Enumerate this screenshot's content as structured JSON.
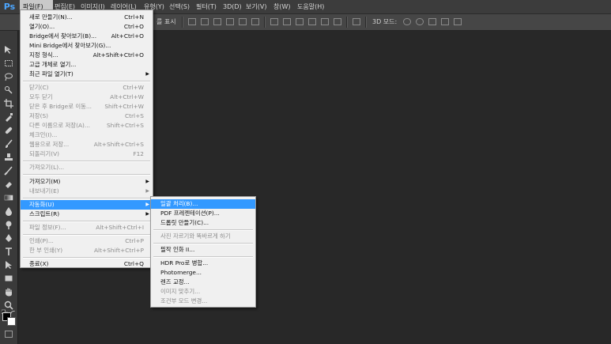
{
  "app": {
    "logo": "Ps"
  },
  "menubar": {
    "items": [
      {
        "label": "파일(F)"
      },
      {
        "label": "편집(E)"
      },
      {
        "label": "이미지(I)"
      },
      {
        "label": "레이어(L)"
      },
      {
        "label": "유형(Y)"
      },
      {
        "label": "선택(S)"
      },
      {
        "label": "필터(T)"
      },
      {
        "label": "3D(D)"
      },
      {
        "label": "보기(V)"
      },
      {
        "label": "창(W)"
      },
      {
        "label": "도움말(H)"
      }
    ]
  },
  "optionsbar": {
    "show_transform": "를 표시",
    "mode_3d": "3D 모드:"
  },
  "file_menu": {
    "items": [
      {
        "label": "새로 만들기(N)...",
        "shortcut": "Ctrl+N",
        "enabled": true
      },
      {
        "label": "열기(O)...",
        "shortcut": "Ctrl+O",
        "enabled": true
      },
      {
        "label": "Bridge에서 찾아보기(B)...",
        "shortcut": "Alt+Ctrl+O",
        "enabled": true
      },
      {
        "label": "Mini Bridge에서 찾아보기(G)...",
        "shortcut": "",
        "enabled": true
      },
      {
        "label": "지정 형식...",
        "shortcut": "Alt+Shift+Ctrl+O",
        "enabled": true
      },
      {
        "label": "고급 개체로 열기...",
        "shortcut": "",
        "enabled": true
      },
      {
        "label": "최근 파일 열기(T)",
        "shortcut": "",
        "enabled": true,
        "submenu": true
      },
      {
        "label": "닫기(C)",
        "shortcut": "Ctrl+W",
        "enabled": false
      },
      {
        "label": "모두 닫기",
        "shortcut": "Alt+Ctrl+W",
        "enabled": false
      },
      {
        "label": "닫은 후 Bridge로 이동...",
        "shortcut": "Shift+Ctrl+W",
        "enabled": false
      },
      {
        "label": "저장(S)",
        "shortcut": "Ctrl+S",
        "enabled": false
      },
      {
        "label": "다른 이름으로 저장(A)...",
        "shortcut": "Shift+Ctrl+S",
        "enabled": false
      },
      {
        "label": "체크인(I)...",
        "shortcut": "",
        "enabled": false
      },
      {
        "label": "웹용으로 저장...",
        "shortcut": "Alt+Shift+Ctrl+S",
        "enabled": false
      },
      {
        "label": "되돌리기(V)",
        "shortcut": "F12",
        "enabled": false
      },
      {
        "label": "가져오기(L)...",
        "shortcut": "",
        "enabled": false
      },
      {
        "label": "가져오기(M)",
        "shortcut": "",
        "enabled": true,
        "submenu": true
      },
      {
        "label": "내보내기(E)",
        "shortcut": "",
        "enabled": false,
        "submenu": true
      },
      {
        "label": "자동화(U)",
        "shortcut": "",
        "enabled": true,
        "submenu": true,
        "highlighted": true
      },
      {
        "label": "스크립트(R)",
        "shortcut": "",
        "enabled": true,
        "submenu": true
      },
      {
        "label": "파일 정보(F)...",
        "shortcut": "Alt+Shift+Ctrl+I",
        "enabled": false
      },
      {
        "label": "인쇄(P)...",
        "shortcut": "Ctrl+P",
        "enabled": false
      },
      {
        "label": "한 부 인쇄(Y)",
        "shortcut": "Alt+Shift+Ctrl+P",
        "enabled": false
      },
      {
        "label": "종료(X)",
        "shortcut": "Ctrl+Q",
        "enabled": true
      }
    ]
  },
  "automate_menu": {
    "items": [
      {
        "label": "일괄 처리(B)...",
        "enabled": true,
        "highlighted": true
      },
      {
        "label": "PDF 프레젠테이션(P)...",
        "enabled": true
      },
      {
        "label": "드롭릿 만들기(C)...",
        "enabled": true
      },
      {
        "label": "사진 자르기와 똑바르게 하기",
        "enabled": false
      },
      {
        "label": "필작 인화 II...",
        "enabled": true
      },
      {
        "label": "HDR Pro로 병합...",
        "enabled": true
      },
      {
        "label": "Photomerge...",
        "enabled": true
      },
      {
        "label": "렌즈 교정...",
        "enabled": true
      },
      {
        "label": "이미지 맞추기...",
        "enabled": false
      },
      {
        "label": "조건부 모드 변경...",
        "enabled": false
      }
    ]
  },
  "toolbar": {
    "tools": [
      "move-tool",
      "marquee-tool",
      "lasso-tool",
      "quick-select-tool",
      "crop-tool",
      "eyedropper-tool",
      "healing-tool",
      "brush-tool",
      "clone-stamp-tool",
      "history-brush-tool",
      "eraser-tool",
      "gradient-tool",
      "blur-tool",
      "dodge-tool",
      "pen-tool",
      "type-tool",
      "path-select-tool",
      "rectangle-tool",
      "hand-tool",
      "zoom-tool"
    ],
    "foreground_color": "#000000",
    "background_color": "#ffffff"
  },
  "colors": {
    "highlight": "#3399ff",
    "menu_bg": "#f0f0f0",
    "workspace": "#282828"
  }
}
